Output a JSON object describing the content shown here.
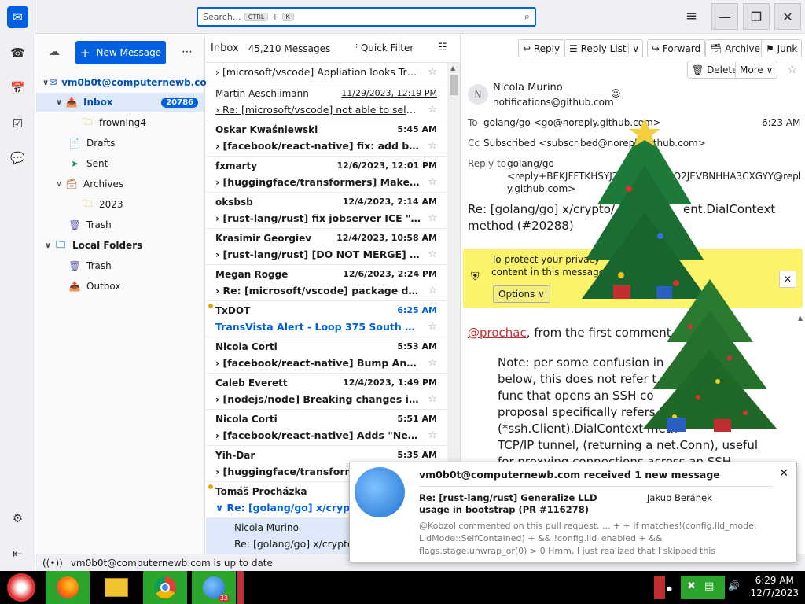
{
  "search": {
    "placeholder": "Search…",
    "kbd1": "CTRL",
    "plus": "+",
    "kbd2": "K"
  },
  "folder_pane": {
    "new_message": "New Message",
    "account": "vm0b0t@computernewb.com",
    "inbox": "Inbox",
    "inbox_count": "20786",
    "folders": [
      {
        "label": "frowning4"
      },
      {
        "label": "Drafts"
      },
      {
        "label": "Sent"
      },
      {
        "label": "Archives"
      },
      {
        "label": "2023"
      },
      {
        "label": "Trash"
      },
      {
        "label": "Local Folders"
      },
      {
        "label": "Trash"
      },
      {
        "label": "Outbox"
      }
    ]
  },
  "message_list": {
    "title": "Inbox",
    "count": "45,210 Messages",
    "quick_filter": "Quick Filter",
    "messages": [
      {
        "from": "",
        "date": "",
        "subject": "[microsoft/vscode] Appliation looks Tras..."
      },
      {
        "from": "Martin Aeschlimann",
        "date": "11/29/2023, 12:19 PM",
        "subject": "Re: [microsoft/vscode] not able to selec..."
      },
      {
        "from": "Oskar Kwaśniewski",
        "date": "5:45 AM",
        "subject": "[facebook/react-native] fix: add build..."
      },
      {
        "from": "fxmarty",
        "date": "12/6/2023, 12:01 PM",
        "subject": "[huggingface/transformers] Make `At..."
      },
      {
        "from": "oksbsb",
        "date": "12/4/2023, 2:14 AM",
        "subject": "[rust-lang/rust] fix jobserver ICE \"job..."
      },
      {
        "from": "Krasimir Georgiev",
        "date": "12/4/2023, 10:58 AM",
        "subject": "[rust-lang/rust] [DO NOT MERGE] up..."
      },
      {
        "from": "Megan Rogge",
        "date": "12/6/2023, 2:24 PM",
        "subject": "Re: [microsoft/vscode] package descr..."
      },
      {
        "from": "TxDOT",
        "date": "6:25 AM",
        "subject": "TransVista Alert - Loop 375 South @ No..."
      },
      {
        "from": "Nicola Corti",
        "date": "5:53 AM",
        "subject": "[facebook/react-native] Bump Androi..."
      },
      {
        "from": "Caleb Everett",
        "date": "12/4/2023, 1:49 PM",
        "subject": "[nodejs/node] Breaking changes in 1..."
      },
      {
        "from": "Nicola Corti",
        "date": "5:51 AM",
        "subject": "[facebook/react-native] Adds \"Needs:..."
      },
      {
        "from": "Yih-Dar",
        "date": "5:35 AM",
        "subject": "[huggingface/transforme"
      },
      {
        "from": "Tomáš Procházka",
        "date": "",
        "subject": "Re: [golang/go] x/crypto"
      },
      {
        "from": "Nicola Murino",
        "date": "",
        "subject": "Re: [golang/go] x/crypto,"
      }
    ]
  },
  "toolbar": {
    "reply": "Reply",
    "reply_list": "Reply List",
    "forward": "Forward",
    "archive": "Archive",
    "junk": "Junk",
    "delete": "Delete",
    "more": "More"
  },
  "message": {
    "sender_initial": "N",
    "sender": "Nicola Murino",
    "sender_email": "notifications@github.com",
    "to_label": "To",
    "to": "golang/go <go@noreply.github.com>",
    "time": "6:23 AM",
    "cc_label": "Cc",
    "cc": "Subscribed <subscribed@noreply.github.com>",
    "replyto_label": "Reply to",
    "replyto_1": "golang/go",
    "replyto_2": "<reply+BEKJFFTKHSYJ2BO4R",
    "replyto_3": "3O2JEVBNHHA3CXGYY@repl",
    "replyto_4": "y.github.com>",
    "subject_1": "Re: [golang/go] x/crypto/",
    "subject_2": "ent.DialContext",
    "subject_3": "method (#20288)",
    "privacy_1": "To protect your privacy",
    "privacy_2": "content in this message.",
    "options": "Options",
    "mention": "@prochac",
    "body_1": ", from the first comment",
    "quote": [
      "Note: per some confusion in",
      "below, this does not refer t",
      "func that opens an SSH co",
      "proposal specifically refers to addin",
      "(*ssh.Client).DialContext meth",
      "TCP/IP tunnel, (returning a net.Conn), useful",
      "for proxying connections across an SSH"
    ]
  },
  "status": {
    "text": "vm0b0t@computernewb.com is up to date"
  },
  "notification": {
    "title": "vm0b0t@computernewb.com received 1 new message",
    "subject": "Re: [rust-lang/rust] Generalize LLD usage in bootstrap (PR #116278)",
    "author": "Jakub Beránek",
    "preview": "@Kobzol commented on this pull request. ... + + if matches!(config.lld_mode, LldMode::SelfContained) + && !config.lld_enabled + && flags.stage.unwrap_or(0) > 0 Hmm, I just realized that I skipped this"
  },
  "taskbar": {
    "time": "6:29 AM",
    "date": "12/7/2023",
    "tb_badge": "33"
  },
  "colors": {
    "accent": "#0060df",
    "privacy": "#fbf36a",
    "taskbar": "#000000",
    "task_green": "#2ba52b"
  }
}
